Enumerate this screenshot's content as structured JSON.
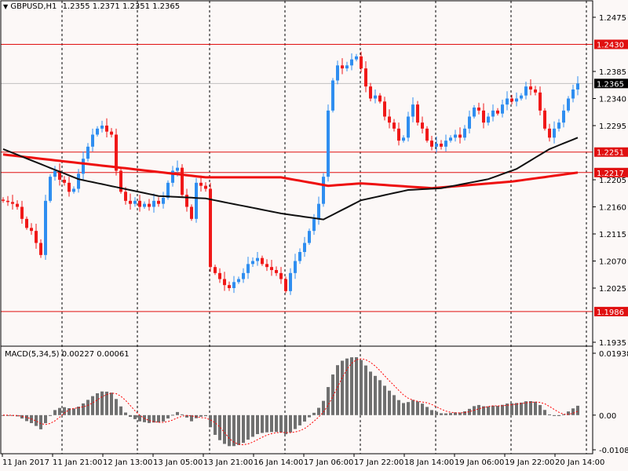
{
  "header": {
    "symbol": "GBPUSD,H1",
    "ohlc": "1.2355 1.2371 1.2351 1.2365"
  },
  "macd_header": {
    "label": "MACD(5,34,5) 0.00227 0.00061"
  },
  "colors": {
    "bull": "#2f8ef0",
    "bear": "#f01818",
    "ma_slow": "#ee1010",
    "ma_fast": "#101010",
    "level": "#e01010",
    "hist": "#707070",
    "signal": "#ff0000"
  },
  "chart_data": {
    "type": "candlestick",
    "title": "GBPUSD,H1",
    "ylim": [
      1.1935,
      1.2475
    ],
    "y_ticks": [
      "1.2475",
      "1.2385",
      "1.2340",
      "1.2295",
      "1.2205",
      "1.2160",
      "1.2115",
      "1.2070",
      "1.2025",
      "1.1935"
    ],
    "levels": [
      {
        "value": 1.243,
        "label": "1.2430",
        "color": "#e01010"
      },
      {
        "value": 1.2251,
        "label": "1.2251",
        "color": "#e01010"
      },
      {
        "value": 1.2217,
        "label": "1.2217",
        "color": "#e01010"
      },
      {
        "value": 1.1986,
        "label": "1.1986",
        "color": "#e01010"
      }
    ],
    "current_price": {
      "value": 1.2365,
      "label": "1.2365"
    },
    "x_labels": [
      "11 Jan 2017",
      "11 Jan 21:00",
      "12 Jan 13:00",
      "13 Jan 05:00",
      "13 Jan 21:00",
      "16 Jan 14:00",
      "17 Jan 06:00",
      "17 Jan 22:00",
      "18 Jan 14:00",
      "19 Jan 06:00",
      "19 Jan 22:00",
      "20 Jan 14:00"
    ],
    "first_open": 1.2172,
    "closes": [
      1.217,
      1.2168,
      1.2165,
      1.216,
      1.214,
      1.2125,
      1.212,
      1.21,
      1.208,
      1.217,
      1.221,
      1.222,
      1.2205,
      1.22,
      1.2185,
      1.219,
      1.2215,
      1.224,
      1.226,
      1.228,
      1.229,
      1.2295,
      1.2285,
      1.228,
      1.222,
      1.2185,
      1.217,
      1.2165,
      1.217,
      1.216,
      1.2165,
      1.216,
      1.217,
      1.2165,
      1.2175,
      1.22,
      1.222,
      1.2225,
      1.218,
      1.216,
      1.214,
      1.22,
      1.2195,
      1.219,
      1.206,
      1.205,
      1.204,
      1.203,
      1.2025,
      1.2035,
      1.204,
      1.205,
      1.2065,
      1.207,
      1.2075,
      1.2065,
      1.206,
      1.2055,
      1.205,
      1.204,
      1.202,
      1.205,
      1.207,
      1.2085,
      1.21,
      1.212,
      1.214,
      1.2165,
      1.221,
      1.232,
      1.237,
      1.2395,
      1.239,
      1.2395,
      1.2405,
      1.241,
      1.239,
      1.236,
      1.234,
      1.2345,
      1.2335,
      1.231,
      1.23,
      1.229,
      1.227,
      1.2275,
      1.231,
      1.233,
      1.23,
      1.229,
      1.227,
      1.226,
      1.2265,
      1.226,
      1.227,
      1.2275,
      1.228,
      1.2275,
      1.229,
      1.231,
      1.2325,
      1.232,
      1.23,
      1.231,
      1.232,
      1.2315,
      1.233,
      1.234,
      1.2335,
      1.234,
      1.2345,
      1.236,
      1.2355,
      1.235,
      1.232,
      1.229,
      1.2275,
      1.229,
      1.23,
      1.232,
      1.234,
      1.2355,
      1.2365
    ],
    "ma_slow_points": [
      [
        0,
        1.2247
      ],
      [
        25,
        1.2225
      ],
      [
        43,
        1.2209
      ],
      [
        59,
        1.2209
      ],
      [
        69,
        1.2195
      ],
      [
        76,
        1.2199
      ],
      [
        91,
        1.2191
      ],
      [
        108,
        1.2202
      ],
      [
        122,
        1.2217
      ]
    ],
    "ma_fast_points": [
      [
        0,
        1.2256
      ],
      [
        16,
        1.2206
      ],
      [
        33,
        1.2178
      ],
      [
        43,
        1.2174
      ],
      [
        59,
        1.2149
      ],
      [
        68,
        1.2139
      ],
      [
        76,
        1.2171
      ],
      [
        86,
        1.2188
      ],
      [
        93,
        1.2191
      ],
      [
        103,
        1.2206
      ],
      [
        109,
        1.2223
      ],
      [
        116,
        1.2256
      ],
      [
        122,
        1.2275
      ]
    ],
    "macd": {
      "fast": 5,
      "slow": 34,
      "signal": 5,
      "ylim": [
        -0.01086,
        0.01938
      ],
      "y_ticks": [
        "0.01938",
        "0.00",
        "-0.01086"
      ]
    }
  }
}
